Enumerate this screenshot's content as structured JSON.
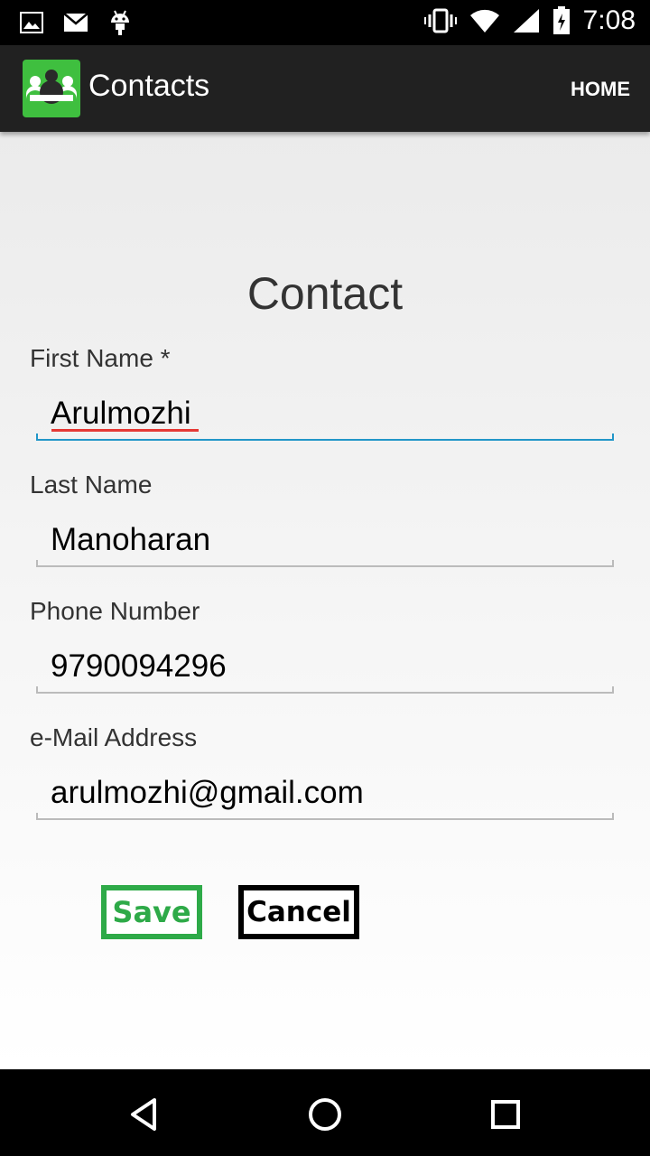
{
  "status_bar": {
    "time": "7:08",
    "icons": [
      "image-icon",
      "mail-icon",
      "android-icon",
      "vibrate-icon",
      "wifi-icon",
      "signal-icon",
      "battery-icon"
    ]
  },
  "action_bar": {
    "title": "Contacts",
    "home_label": "HOME",
    "icon": "contacts-app-icon",
    "background": "#212121"
  },
  "form": {
    "title": "Contact",
    "fields": [
      {
        "label": "First Name *",
        "value": "Arulmozhi"
      },
      {
        "label": "Last Name",
        "value": "Manoharan"
      },
      {
        "label": "Phone Number",
        "value": "9790094296"
      },
      {
        "label": "e-Mail Address",
        "value": "arulmozhi@gmail.com"
      }
    ],
    "save_label": "Save",
    "cancel_label": "Cancel"
  },
  "colors": {
    "save_accent": "#2eaa48",
    "focus_underline": "#2196c8",
    "app_icon": "#3fbf3f"
  },
  "nav_bar": {
    "icons": [
      "back-icon",
      "home-icon",
      "recents-icon"
    ]
  }
}
